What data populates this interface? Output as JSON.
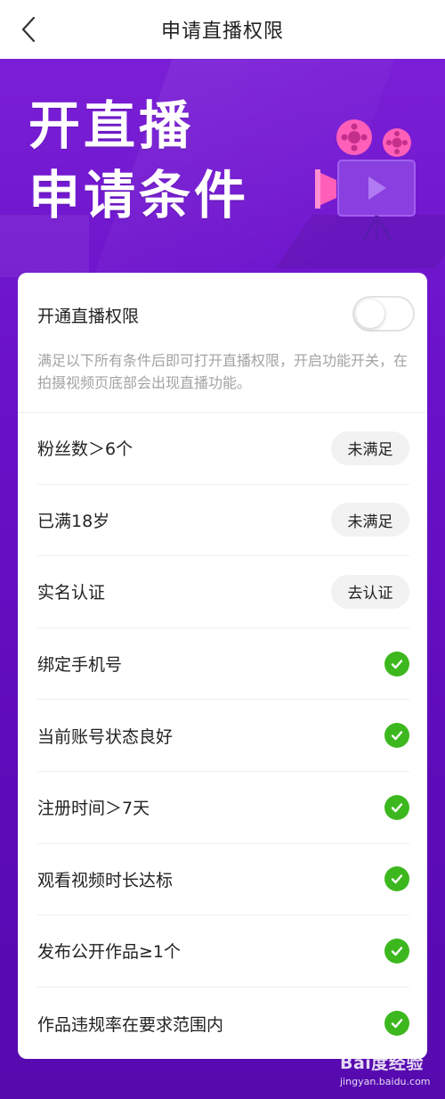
{
  "nav": {
    "title": "申请直播权限"
  },
  "hero": {
    "line1": "开直播",
    "line2": "申请条件"
  },
  "toggle": {
    "label": "开通直播权限",
    "enabled": false,
    "description": "满足以下所有条件后即可打开直播权限，开启功能开关，在拍摄视频页底部会出现直播功能。"
  },
  "conditions": [
    {
      "label": "粉丝数＞6个",
      "status": "pill",
      "action": "未满足"
    },
    {
      "label": "已满18岁",
      "status": "pill",
      "action": "未满足"
    },
    {
      "label": "实名认证",
      "status": "pill",
      "action": "去认证"
    },
    {
      "label": "绑定手机号",
      "status": "check-icon"
    },
    {
      "label": "当前账号状态良好",
      "status": "check-icon"
    },
    {
      "label": "注册时间＞7天",
      "status": "check-icon"
    },
    {
      "label": "观看视频时长达标",
      "status": "check-icon"
    },
    {
      "label": "发布公开作品≥1个",
      "status": "check-icon"
    },
    {
      "label": "作品违规率在要求范围内",
      "status": "check-icon"
    }
  ],
  "watermark": {
    "brand": "Bai度经验",
    "url": "jingyan.baidu.com"
  },
  "colors": {
    "accent_purple": "#6a12c9",
    "check_green": "#3cb81e",
    "pill_bg": "#f2f2f2",
    "camera_pink": "#ff5fb8"
  }
}
